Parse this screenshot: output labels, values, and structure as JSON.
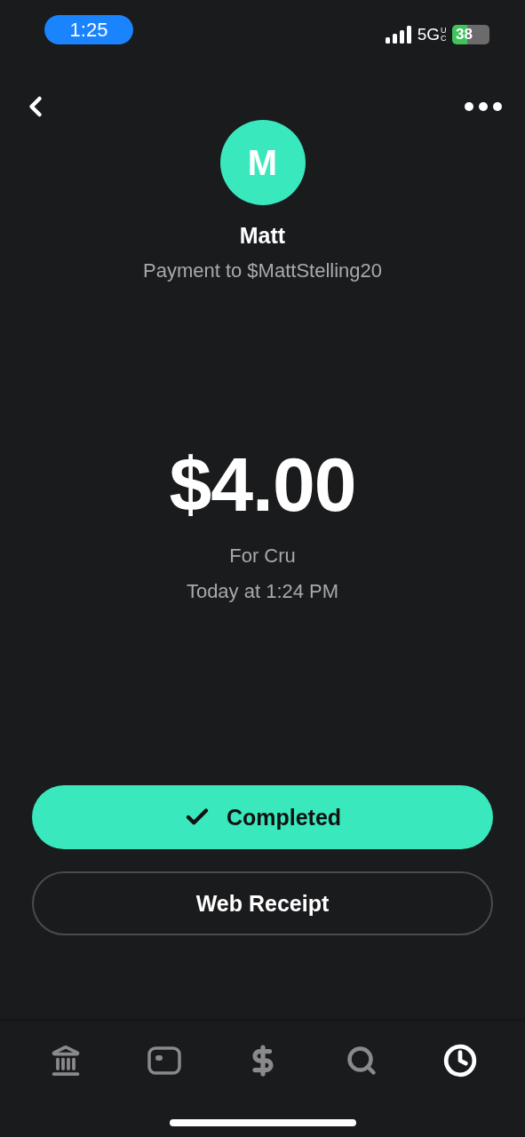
{
  "status_bar": {
    "time": "1:25",
    "network": "5G",
    "network_sub": "UC",
    "battery": "38"
  },
  "avatar": {
    "initial": "M"
  },
  "name": "Matt",
  "subtitle": "Payment to $MattStelling20",
  "amount": "$4.00",
  "note": "For Cru",
  "date": "Today at 1:24 PM",
  "status_button": "Completed",
  "receipt_button": "Web Receipt",
  "tabs": [
    {
      "kind": "banking",
      "selected": false
    },
    {
      "kind": "card",
      "selected": false
    },
    {
      "kind": "pay",
      "selected": false
    },
    {
      "kind": "search",
      "selected": false
    },
    {
      "kind": "activity",
      "selected": true
    }
  ]
}
